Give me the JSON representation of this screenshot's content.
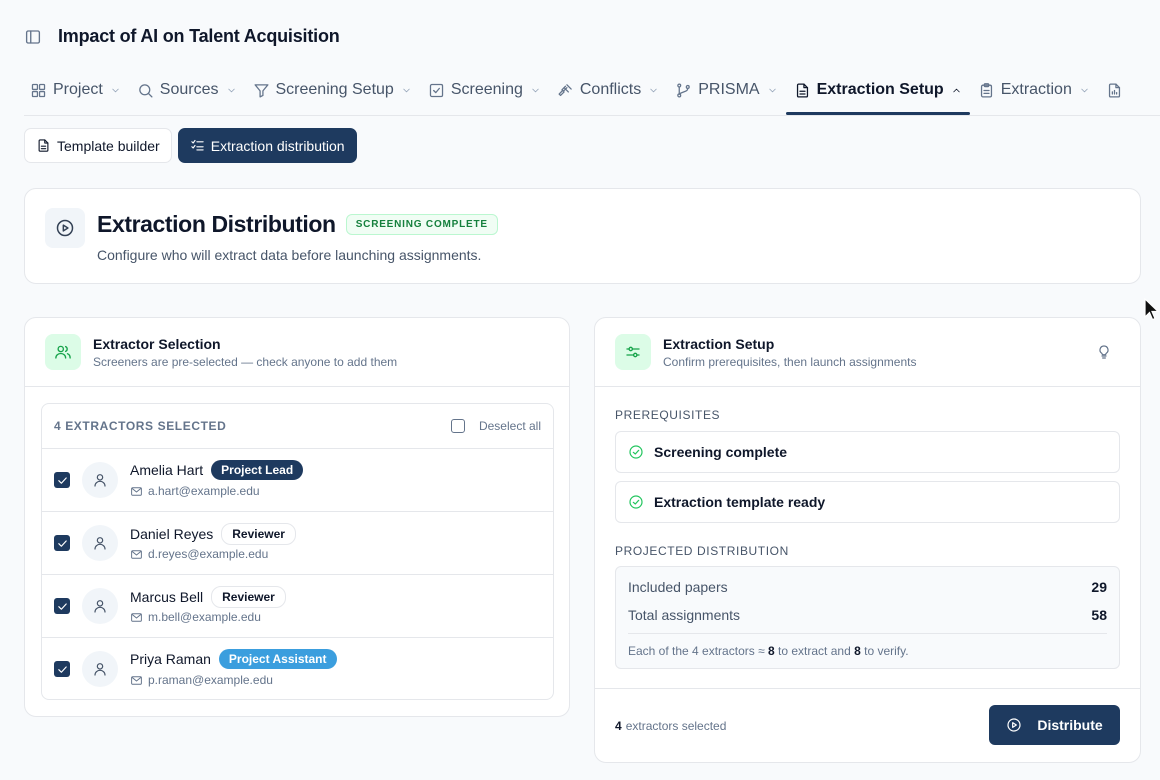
{
  "project": {
    "title": "Impact of AI on Talent Acquisition"
  },
  "nav": {
    "items": [
      {
        "label": "Project",
        "icon": "grid-icon",
        "active": false
      },
      {
        "label": "Sources",
        "icon": "search-icon",
        "active": false
      },
      {
        "label": "Screening Setup",
        "icon": "filter-icon",
        "active": false
      },
      {
        "label": "Screening",
        "icon": "check-square-icon",
        "active": false
      },
      {
        "label": "Conflicts",
        "icon": "gavel-icon",
        "active": false
      },
      {
        "label": "PRISMA",
        "icon": "branch-icon",
        "active": false
      },
      {
        "label": "Extraction Setup",
        "icon": "document-icon",
        "active": true
      },
      {
        "label": "Extraction",
        "icon": "clipboard-icon",
        "active": false
      }
    ]
  },
  "subtabs": {
    "template_builder": "Template builder",
    "extraction_distribution": "Extraction distribution"
  },
  "hero": {
    "title": "Extraction Distribution",
    "badge": "SCREENING COMPLETE",
    "subtitle": "Configure who will extract data before launching assignments."
  },
  "extractor_panel": {
    "title": "Extractor Selection",
    "subtitle": "Screeners are pre-selected — check anyone to add them",
    "count_label": "4 EXTRACTORS SELECTED",
    "deselect_label": "Deselect all",
    "extractors": [
      {
        "name": "Amelia Hart",
        "role": "Project Lead",
        "email": "a.hart@example.edu",
        "checked": true
      },
      {
        "name": "Daniel Reyes",
        "role": "Reviewer",
        "email": "d.reyes@example.edu",
        "checked": true
      },
      {
        "name": "Marcus Bell",
        "role": "Reviewer",
        "email": "m.bell@example.edu",
        "checked": true
      },
      {
        "name": "Priya Raman",
        "role": "Project Assistant",
        "email": "p.raman@example.edu",
        "checked": true
      }
    ]
  },
  "setup_panel": {
    "title": "Extraction Setup",
    "subtitle": "Confirm prerequisites, then launch assignments",
    "prereq_label": "PREREQUISITES",
    "prereqs": [
      "Screening complete",
      "Extraction template ready"
    ],
    "projected_label": "PROJECTED DISTRIBUTION",
    "included_papers_label": "Included papers",
    "included_papers_value": "29",
    "total_assignments_label": "Total assignments",
    "total_assignments_value": "58",
    "note_prefix": "Each of the 4 extractors ≈",
    "note_extract_n": "8",
    "note_mid": "to extract and",
    "note_verify_n": "8",
    "note_suffix": "to verify.",
    "footer_count": "4",
    "footer_label": "extractors selected",
    "distribute_label": "Distribute"
  },
  "colors": {
    "primary": "#1e3a5f",
    "success": "#16a34a",
    "assistant_badge": "#3b9ede"
  }
}
